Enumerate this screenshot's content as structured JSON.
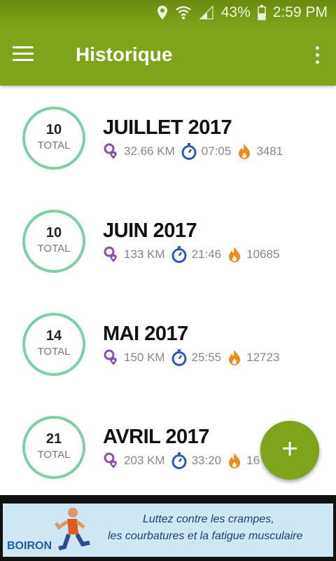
{
  "status_bar": {
    "battery_percent": "43%",
    "time": "2:59 PM",
    "icons": [
      "location-icon",
      "wifi-icon",
      "signal-icon",
      "battery-icon"
    ]
  },
  "app_bar": {
    "title": "Historique",
    "left_icon": "menu-icon",
    "right_icon": "more-options-icon",
    "color": "#7fa31a"
  },
  "history": [
    {
      "count": "10",
      "count_label": "TOTAL",
      "month": "JUILLET 2017",
      "distance": "32.66 KM",
      "duration": "07:05",
      "calories": "3481"
    },
    {
      "count": "10",
      "count_label": "TOTAL",
      "month": "JUIN 2017",
      "distance": "133 KM",
      "duration": "21:46",
      "calories": "10685"
    },
    {
      "count": "14",
      "count_label": "TOTAL",
      "month": "MAI 2017",
      "distance": "150 KM",
      "duration": "25:55",
      "calories": "12723"
    },
    {
      "count": "21",
      "count_label": "TOTAL",
      "month": "AVRIL 2017",
      "distance": "203 KM",
      "duration": "33:20",
      "calories": "16"
    }
  ],
  "fab": {
    "label": "+",
    "icon": "add-icon"
  },
  "ad": {
    "line1": "Luttez contre les crampes,",
    "line2": "les courbatures et la fatigue musculaire",
    "brand": "BOIRON"
  },
  "colors": {
    "accent": "#7fa31a",
    "ring": "#7dd0a5",
    "distance_icon": "#8a4fb0",
    "time_icon": "#2d57b8",
    "calories_icon": "#f08a1a"
  }
}
